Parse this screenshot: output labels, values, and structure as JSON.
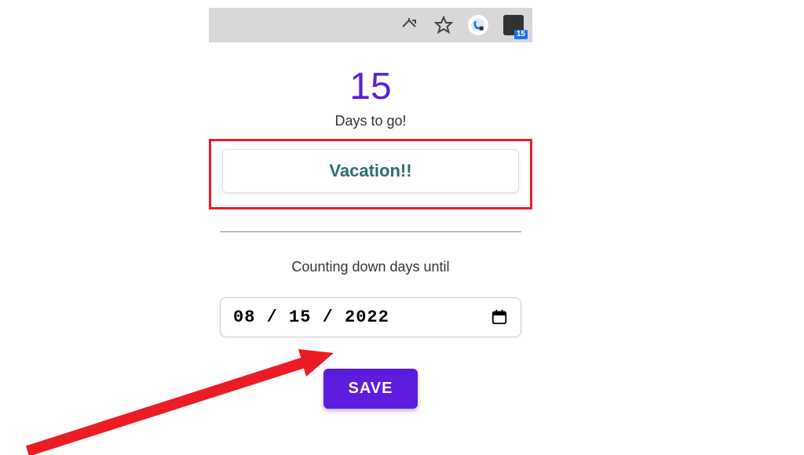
{
  "toolbar": {
    "ext_badge": "15"
  },
  "countdown": {
    "number": "15",
    "days_label": "Days to go!",
    "event_title": "Vacation!!",
    "counting_label": "Counting down days until",
    "date_value": "08 / 15 / 2022",
    "save_label": "SAVE"
  }
}
